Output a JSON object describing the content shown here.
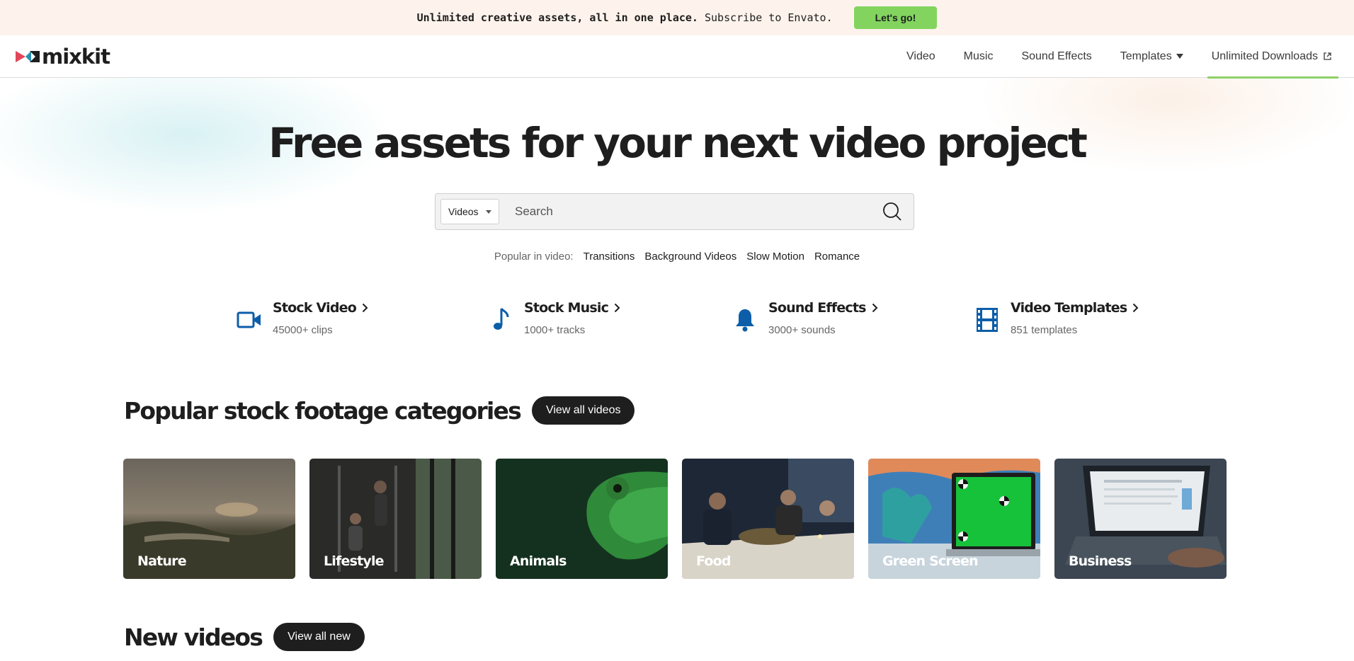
{
  "promo": {
    "bold_text": "Unlimited creative assets, all in one place.",
    "text": "Subscribe to Envato.",
    "button_label": "Let's go!"
  },
  "brand": {
    "logo_text": "mixkit"
  },
  "nav": {
    "items": [
      {
        "label": "Video"
      },
      {
        "label": "Music"
      },
      {
        "label": "Sound Effects"
      },
      {
        "label": "Templates"
      },
      {
        "label": "Unlimited Downloads"
      }
    ]
  },
  "hero": {
    "title": "Free assets for your next video project"
  },
  "search": {
    "type_selected": "Videos",
    "placeholder": "Search",
    "value": ""
  },
  "popular": {
    "label": "Popular in video:",
    "tags": [
      "Transitions",
      "Background Videos",
      "Slow Motion",
      "Romance"
    ]
  },
  "categories": [
    {
      "title": "Stock Video",
      "sub": "45000+ clips",
      "icon": "video-camera-icon"
    },
    {
      "title": "Stock Music",
      "sub": "1000+ tracks",
      "icon": "music-note-icon"
    },
    {
      "title": "Sound Effects",
      "sub": "3000+ sounds",
      "icon": "bell-icon"
    },
    {
      "title": "Video Templates",
      "sub": "851 templates",
      "icon": "film-strip-icon"
    }
  ],
  "footage": {
    "title": "Popular stock footage categories",
    "button_label": "View all videos",
    "tiles": [
      {
        "label": "Nature"
      },
      {
        "label": "Lifestyle"
      },
      {
        "label": "Animals"
      },
      {
        "label": "Food"
      },
      {
        "label": "Green Screen"
      },
      {
        "label": "Business"
      }
    ]
  },
  "new_videos": {
    "title": "New videos",
    "button_label": "View all new"
  },
  "colors": {
    "promo_bg": "#fdf3ec",
    "promo_button": "#82d45f",
    "nav_active_underline": "#8ed16a",
    "icon_blue": "#0d5ea8",
    "pill_bg": "#1e1e1e"
  }
}
